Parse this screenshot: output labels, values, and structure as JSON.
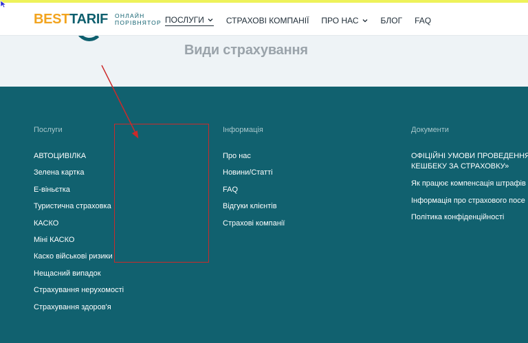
{
  "header": {
    "logo": {
      "best": "BEST",
      "tarif": "TARIF",
      "tagline": "ОНЛАЙН ПОРІВНЯТОР"
    },
    "nav": [
      {
        "label": "ПОСЛУГИ",
        "has_dropdown": true,
        "active": true
      },
      {
        "label": "СТРАХОВІ КОМПАНІЇ",
        "has_dropdown": false
      },
      {
        "label": "ПРО НАС",
        "has_dropdown": true
      },
      {
        "label": "БЛОГ",
        "has_dropdown": false
      },
      {
        "label": "FAQ",
        "has_dropdown": false
      }
    ]
  },
  "hero": {
    "title": "Види страхування"
  },
  "footer": {
    "services": {
      "title": "Послуги",
      "links": [
        "АВТОЦИВІЛКА",
        "Зелена картка",
        "Е-віньєтка",
        "Туристична страховка",
        "КАСКО",
        "Міні КАСКО",
        "Каско військові ризики",
        "Нещасний випадок",
        "Страхування нерухомості",
        "Страхування здоров'я"
      ]
    },
    "info": {
      "title": "Інформація",
      "links": [
        "Про нас",
        "Новини/Статті",
        "FAQ",
        "Відгуки клієнтів",
        "Страхові компанії"
      ]
    },
    "docs": {
      "title": "Документи",
      "links": [
        "ОФІЦІЙНІ УМОВИ ПРОВЕДЕННЯ КЕШБЕКУ ЗА СТРАХОВКУ»",
        "Як працює компенсація штрафів",
        "Інформація про страхового посе",
        "Політика конфіденційності"
      ]
    }
  },
  "colors": {
    "brand_orange": "#f2a41f",
    "brand_teal": "#0e5f6e",
    "footer_bg": "#11616f",
    "annotation_red": "#cc2a2a",
    "top_strip": "#eef25a"
  }
}
